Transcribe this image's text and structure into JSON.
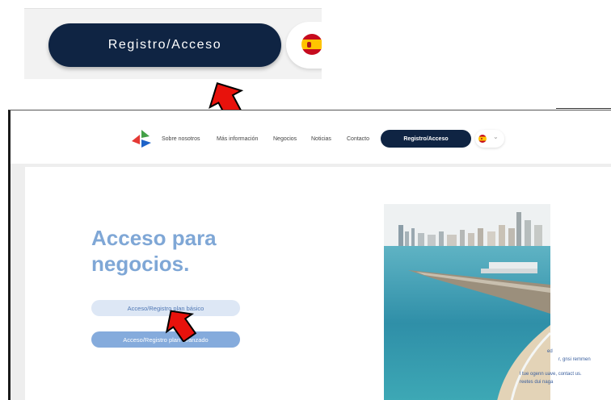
{
  "zoom": {
    "button_label": "Registro/Acceso"
  },
  "nav": {
    "links": [
      "Sobre nosotros",
      "Más información",
      "Negocios",
      "Noticias",
      "Contacto"
    ],
    "cta_label": "Registro/Acceso"
  },
  "main": {
    "heading_line1": "Acceso para",
    "heading_line2": "negocios.",
    "basic_button": "Acceso/Registro plan básico",
    "advanced_button": "Acceso/Registro plan avanzado"
  },
  "photo_overlay": {
    "line1": "ed",
    "line2": "r, gnsi remmen",
    "line3": "l tue ogenn uave, contact us.",
    "line4": "reetes dui naga"
  },
  "colors": {
    "navy": "#0f2443",
    "accent_blue": "#7fa7d6",
    "arrow_red": "#e8120c"
  }
}
